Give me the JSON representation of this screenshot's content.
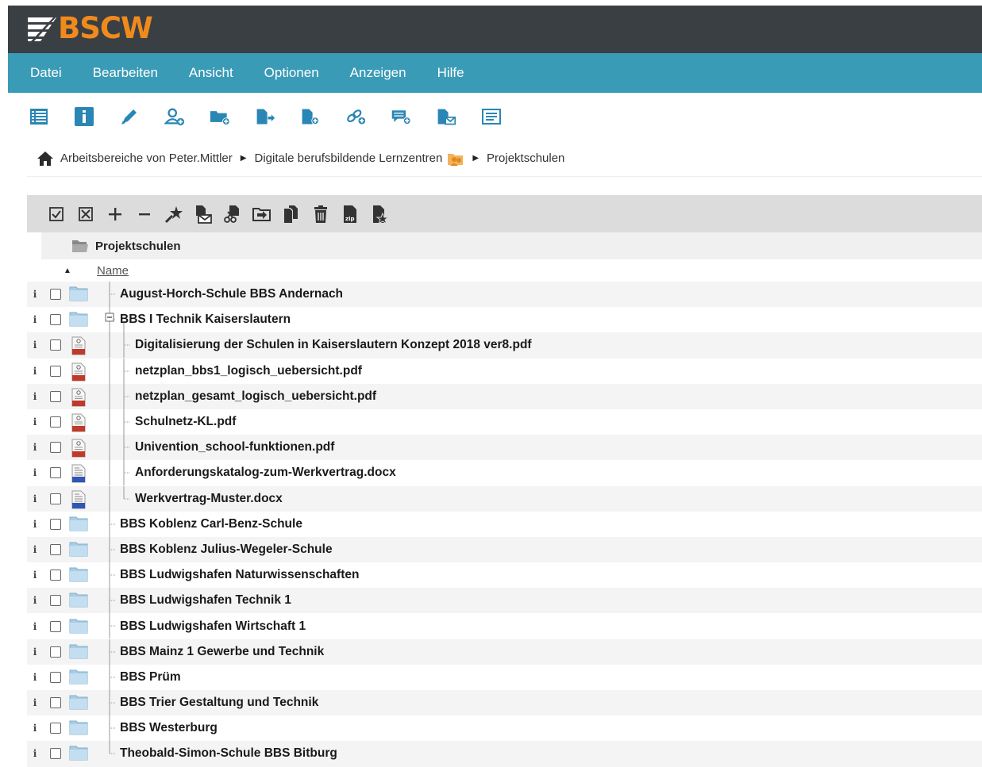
{
  "app": {
    "logo_text": "BSCW"
  },
  "menu": [
    "Datei",
    "Bearbeiten",
    "Ansicht",
    "Optionen",
    "Anzeigen",
    "Hilfe"
  ],
  "toolbar": [
    "list-view-icon",
    "info-icon",
    "edit-pencil-icon",
    "add-member-icon",
    "new-folder-icon",
    "move-document-icon",
    "new-document-icon",
    "add-url-icon",
    "new-discussion-icon",
    "send-mail-icon",
    "note-icon"
  ],
  "breadcrumb": {
    "items": [
      "Arbeitsbereiche von Peter.Mittler",
      "Digitale berufsbildende Lernzentren",
      "Projektschulen"
    ]
  },
  "actions": [
    "select-all-icon",
    "deselect-all-icon",
    "expand-icon",
    "collapse-icon",
    "rate-icon",
    "send-icon",
    "cut-icon",
    "move-to-icon",
    "copy-icon",
    "delete-icon",
    "zip-icon",
    "mark-read-icon"
  ],
  "listing": {
    "container": "Projektschulen",
    "sort_column": "Name",
    "rows": [
      {
        "name": "August-Horch-Schule BBS Andernach",
        "type": "folder",
        "level": 0
      },
      {
        "name": "BBS I Technik Kaiserslautern",
        "type": "folder",
        "level": 0,
        "expanded": true
      },
      {
        "name": "Digitalisierung der Schulen in Kaiserslautern Konzept 2018 ver8.pdf",
        "type": "pdf",
        "level": 1
      },
      {
        "name": "netzplan_bbs1_logisch_uebersicht.pdf",
        "type": "pdf",
        "level": 1
      },
      {
        "name": "netzplan_gesamt_logisch_uebersicht.pdf",
        "type": "pdf",
        "level": 1
      },
      {
        "name": "Schulnetz-KL.pdf",
        "type": "pdf",
        "level": 1
      },
      {
        "name": "Univention_school-funktionen.pdf",
        "type": "pdf",
        "level": 1
      },
      {
        "name": "Anforderungskatalog-zum-Werkvertrag.docx",
        "type": "docx",
        "level": 1
      },
      {
        "name": "Werkvertrag-Muster.docx",
        "type": "docx",
        "level": 1
      },
      {
        "name": "BBS Koblenz Carl-Benz-Schule",
        "type": "folder",
        "level": 0
      },
      {
        "name": "BBS Koblenz Julius-Wegeler-Schule",
        "type": "folder",
        "level": 0
      },
      {
        "name": "BBS Ludwigshafen Naturwissenschaften",
        "type": "folder",
        "level": 0
      },
      {
        "name": "BBS Ludwigshafen Technik 1",
        "type": "folder",
        "level": 0
      },
      {
        "name": "BBS Ludwigshafen Wirtschaft 1",
        "type": "folder",
        "level": 0
      },
      {
        "name": "BBS Mainz 1 Gewerbe und Technik",
        "type": "folder",
        "level": 0
      },
      {
        "name": "BBS Prüm",
        "type": "folder",
        "level": 0
      },
      {
        "name": "BBS Trier Gestaltung und Technik",
        "type": "folder",
        "level": 0
      },
      {
        "name": "BBS Westerburg",
        "type": "folder",
        "level": 0
      },
      {
        "name": "Theobald-Simon-Schule BBS Bitburg",
        "type": "folder",
        "level": 0
      }
    ]
  },
  "colors": {
    "header": "#3a3f44",
    "menubar": "#3a9bb7",
    "logo": "#f08a1c",
    "icon_blue": "#2a86b4",
    "folder": "#a9cde3",
    "pdf_red": "#c0392b",
    "docx_blue": "#2f55b5"
  }
}
